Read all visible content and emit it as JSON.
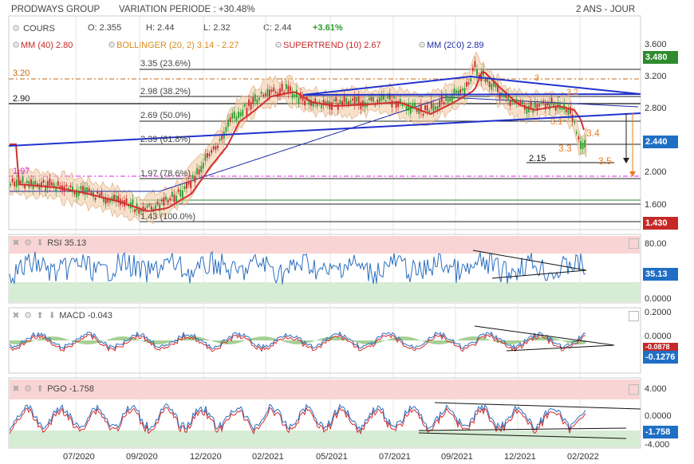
{
  "header": {
    "name": "PRODWAYS GROUP",
    "variation": "VARIATION PERIODE : +30.48%",
    "period": "2 ANS - JOUR"
  },
  "legend_row1": {
    "series": "COURS",
    "open": "O: 2.355",
    "high": "H: 2.44",
    "low": "L: 2.32",
    "close": "C: 2.44",
    "change": "+3.61%"
  },
  "legend_row2": {
    "mm40": "MM (40)  2.80",
    "bollinger": "BOLLINGER (20, 2)  3.14 - 2.27",
    "supertrend": "SUPERTREND (10)  2.67",
    "mm200": "MM (200)  2.89"
  },
  "colors": {
    "price_up": "#2a9d2a",
    "price_down": "#c62828",
    "mm40": "#d32f2f",
    "mm200": "#1e2aa8",
    "bollinger": "#f0c8a0",
    "trendline": "#2233cc",
    "rsi_line": "#2b6fc0",
    "overbought": "#f9d4d4",
    "oversold": "#d6ecd4",
    "tag_green": "#2e8b2e",
    "tag_blue": "#1f6fc5",
    "tag_red": "#c62828",
    "magenta": "#e020e0",
    "orange": "#e67e22"
  },
  "main": {
    "yticks": [
      "3.600",
      "3.200",
      "2.800",
      "2.400",
      "2.000",
      "1.600"
    ],
    "tags": {
      "high": "3.480",
      "last": "2.440",
      "low": "1.430"
    },
    "fib_levels": [
      {
        "label": "3.35 (23.6%)"
      },
      {
        "label": "2.98 (38.2%)"
      },
      {
        "label": "2.69 (50.0%)"
      },
      {
        "label": "2.39 (61.8%)"
      },
      {
        "label": "1.97 (78.6%)"
      },
      {
        "label": "1.43 (100.0%)"
      }
    ],
    "level_320": "3.20",
    "level_290": "2.90",
    "level_197": "1.97",
    "annotations": {
      "a215": "2.15",
      "a34": "3.4",
      "a33": "3.3",
      "a35": "3.5",
      "a31": "3.1",
      "a32": "3.2",
      "a3": "3"
    }
  },
  "rsi": {
    "label": "RSI",
    "value": "35.13",
    "yticks": [
      "80.00",
      "0.0000"
    ],
    "tag": "35.13"
  },
  "macd": {
    "label": "MACD",
    "value": "-0.043",
    "yticks": [
      "0.2000",
      "0.0000"
    ],
    "tag": "-0.1276",
    "tag2": "-0.0878"
  },
  "pgo": {
    "label": "PGO",
    "value": "-1.758",
    "yticks": [
      "4.000",
      "0.0000",
      "-4.000"
    ],
    "tag": "-1.758"
  },
  "xaxis": [
    "07/2020",
    "09/2020",
    "12/2020",
    "02/2021",
    "05/2021",
    "07/2021",
    "09/2021",
    "12/2021",
    "02/2022"
  ]
}
